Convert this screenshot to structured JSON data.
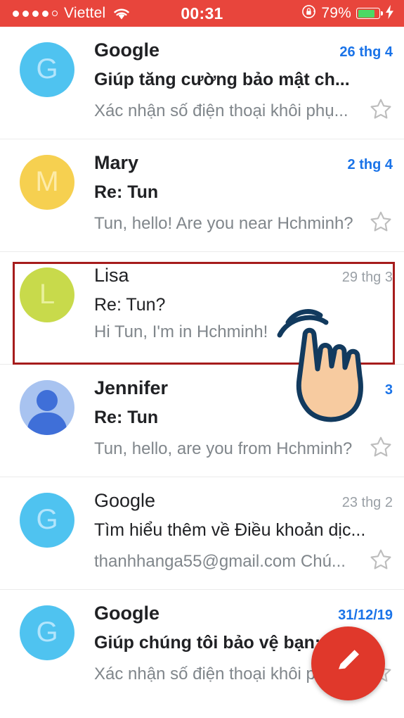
{
  "status_bar": {
    "signal_dots_filled": 4,
    "signal_dots_total": 5,
    "carrier": "Viettel",
    "wifi_icon": "wifi-icon",
    "time": "00:31",
    "rotation_lock_icon": "rotation-lock-icon",
    "battery_percent": "79%",
    "battery_level": 80,
    "battery_color": "#4cd964",
    "charging_icon": "lightning-bolt-icon",
    "background_color": "#e8453c"
  },
  "theme": {
    "unread_date_color": "#1a73e8",
    "read_date_color": "#9aa0a6",
    "snippet_color": "#80868b",
    "star_color": "#bdbdbd",
    "annotation_color": "#a61c1c",
    "fab_color": "#e0382b",
    "hand_fill": "#f7cba0",
    "hand_outline": "#123a5e"
  },
  "emails": [
    {
      "avatar": {
        "type": "letter",
        "letter": "G",
        "bg": "#4fc3f0",
        "fg": "#b3e5fc"
      },
      "sender": "Google",
      "date": "26 thg 4",
      "subject": "Giúp tăng cường bảo mật ch...",
      "snippet": "Xác nhận số điện thoại khôi phụ...",
      "unread": true,
      "starred": false,
      "star_visible": true
    },
    {
      "avatar": {
        "type": "letter",
        "letter": "M",
        "bg": "#f6d050",
        "fg": "#fdeba8"
      },
      "sender": "Mary",
      "date": "2 thg 4",
      "subject": "Re: Tun",
      "snippet": "Tun, hello! Are you near Hchminh?",
      "unread": true,
      "starred": false,
      "star_visible": true
    },
    {
      "avatar": {
        "type": "letter",
        "letter": "L",
        "bg": "#c8da4b",
        "fg": "#e8f09a"
      },
      "sender": "Lisa",
      "date": "29 thg 3",
      "subject": "Re: Tun?",
      "snippet": "Hi Tun, I'm in Hchminh!",
      "unread": false,
      "starred": false,
      "star_visible": false,
      "highlighted": true
    },
    {
      "avatar": {
        "type": "silhouette",
        "letter": "",
        "bg": "#a8c3f0",
        "fg": "#3f6fd8"
      },
      "sender": "Jennifer",
      "date": "3",
      "subject": "Re: Tun",
      "snippet": "Tun, hello, are you from Hchminh?",
      "unread": true,
      "starred": false,
      "star_visible": true
    },
    {
      "avatar": {
        "type": "letter",
        "letter": "G",
        "bg": "#4fc3f0",
        "fg": "#b3e5fc"
      },
      "sender": "Google",
      "date": "23 thg 2",
      "subject": "Tìm hiểu thêm về Điều khoản dịc...",
      "snippet": "thanhhanga55@gmail.com Chú...",
      "unread": false,
      "starred": false,
      "star_visible": true
    },
    {
      "avatar": {
        "type": "letter",
        "letter": "G",
        "bg": "#4fc3f0",
        "fg": "#b3e5fc"
      },
      "sender": "Google",
      "date": "31/12/19",
      "subject": "Giúp chúng tôi bảo vệ bạn: ...",
      "snippet": "Xác nhận số điện thoại khôi phụ...",
      "unread": true,
      "starred": false,
      "star_visible": true
    }
  ],
  "compose_fab": {
    "icon": "pencil-icon",
    "label": "Compose"
  }
}
